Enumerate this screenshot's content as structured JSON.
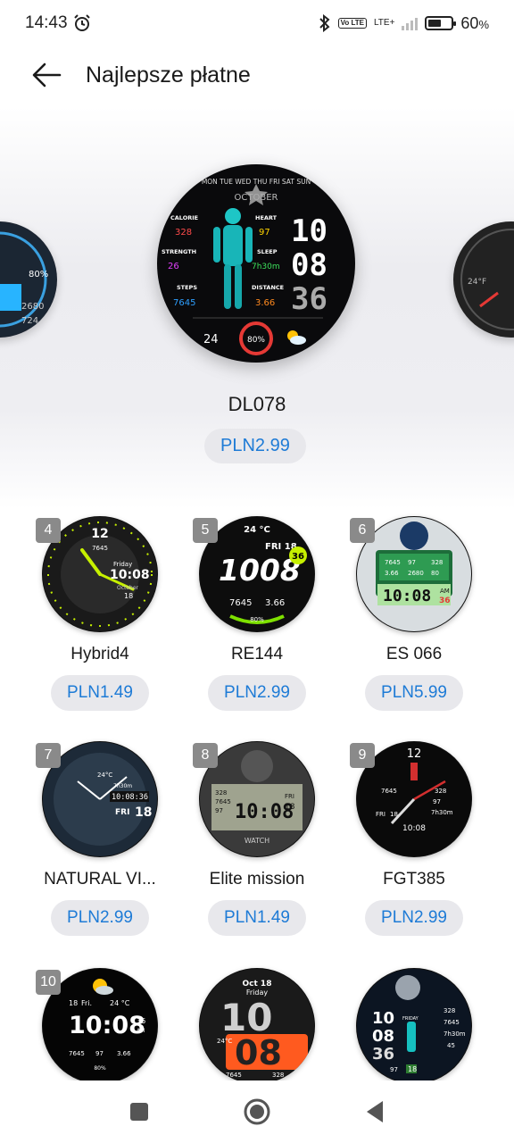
{
  "status": {
    "time": "14:43",
    "network": "LTE+",
    "volte": "Vo LTE",
    "battery": "60",
    "battery_level": 0.6
  },
  "header": {
    "title": "Najlepsze płatne"
  },
  "featured": {
    "name": "DL078",
    "price": "PLN2.99",
    "face": {
      "hour": "10",
      "minute": "08",
      "second": "36",
      "calorie": "328",
      "heart": "97",
      "strength": "26",
      "sleep": "7h30m",
      "steps": "7645",
      "distance": "3.66",
      "temp": "24",
      "battery": "80%",
      "days": "MON TUE WED THU FRI SAT SUN",
      "month": "OCTOBER",
      "lbl_calorie": "CALORIE",
      "lbl_heart": "HEART",
      "lbl_strength": "STRENGTH",
      "lbl_sleep": "SLEEP",
      "lbl_steps": "STEPS",
      "lbl_distance": "DISTANCE"
    }
  },
  "items": [
    {
      "rank": "4",
      "name": "Hybrid4",
      "price": "PLN1.49",
      "time": "10:08",
      "sub": "7645",
      "day": "Friday",
      "month": "October",
      "date": "18"
    },
    {
      "rank": "5",
      "name": "RE144",
      "price": "PLN2.99",
      "time": "1008",
      "temp": "24 °C",
      "day": "FRI 18",
      "badge": "36",
      "steps": "7645",
      "dist": "3.66",
      "batt": "80%"
    },
    {
      "rank": "6",
      "name": "ES 066",
      "price": "PLN5.99",
      "time": "10:08",
      "ampm": "AM",
      "sec": "36",
      "a": "7645",
      "b": "97",
      "c": "328",
      "d": "3.66",
      "e": "2680",
      "f": "80"
    },
    {
      "rank": "7",
      "name": "NATURAL VI...",
      "price": "PLN2.99",
      "time": "10:08:36",
      "day": "FRI",
      "date": "18",
      "temp": "24°C",
      "sleep": "7h30m"
    },
    {
      "rank": "8",
      "name": "Elite mission",
      "price": "PLN1.49",
      "time": "10:08",
      "day": "FRI",
      "date": "18",
      "a": "328",
      "b": "7645",
      "c": "97",
      "brand": "WATCH"
    },
    {
      "rank": "9",
      "name": "FGT385",
      "price": "PLN2.99",
      "time": "10:08",
      "twelve": "12",
      "a": "7645",
      "b": "328",
      "day": "FRI",
      "date": "18",
      "c": "97",
      "d": "7h30m"
    },
    {
      "rank": "10",
      "name": "",
      "price": "",
      "time": "10:08",
      "sec": "36",
      "ampm": "AM",
      "date": "18",
      "day": "Fri.",
      "temp": "24 °C",
      "a": "7645",
      "b": "97",
      "c": "3.66",
      "batt": "80%"
    },
    {
      "rank": "",
      "name": "",
      "price": "",
      "hour": "10",
      "minute": "08",
      "top": "Oct 18",
      "day": "Friday",
      "a": "7645",
      "b": "328",
      "temp": "24°C"
    },
    {
      "rank": "",
      "name": "",
      "price": "",
      "hour": "10",
      "minute": "08",
      "sec": "36",
      "a": "328",
      "b": "7645",
      "c": "7h30m",
      "d": "45",
      "date": "18",
      "day": "FRIDAY",
      "e": "97"
    }
  ]
}
